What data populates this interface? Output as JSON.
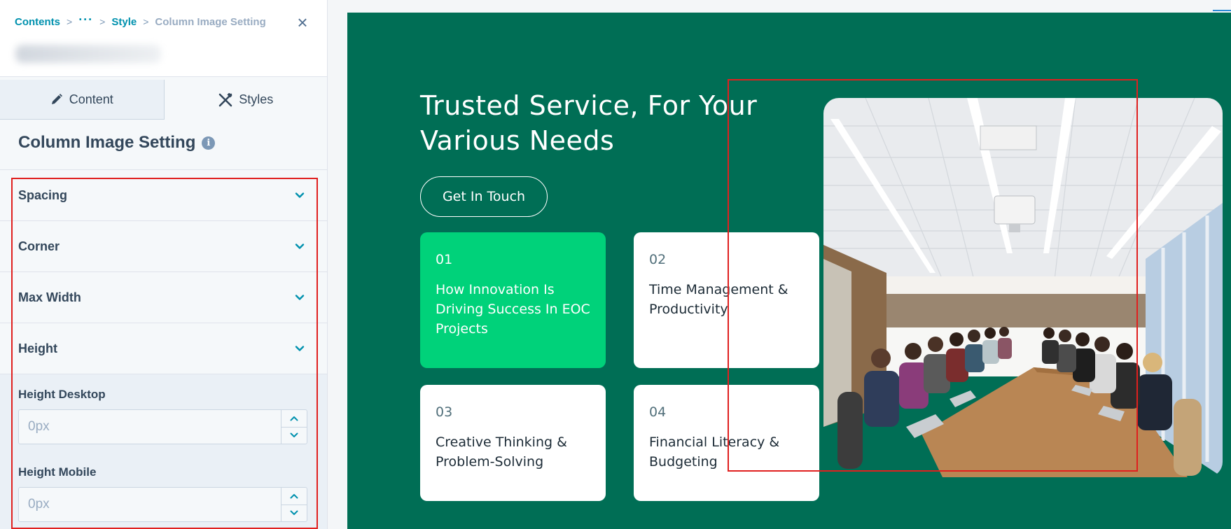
{
  "breadcrumb": {
    "items": [
      "Contents",
      "Style"
    ],
    "current": "Column Image Setting",
    "more": "···",
    "separator": ">"
  },
  "close_icon": "×",
  "tabs": [
    {
      "label": "Content",
      "icon": "pencil-icon"
    },
    {
      "label": "Styles",
      "icon": "brush-tools-icon"
    }
  ],
  "panel": {
    "title": "Column Image Setting",
    "info": "i"
  },
  "accordion": [
    {
      "label": "Spacing"
    },
    {
      "label": "Corner"
    },
    {
      "label": "Max Width"
    },
    {
      "label": "Height"
    }
  ],
  "height_fields": {
    "desktop": {
      "label": "Height Desktop",
      "placeholder": "0px"
    },
    "mobile": {
      "label": "Height Mobile",
      "placeholder": "0px"
    }
  },
  "preview": {
    "headline": "Trusted Service, For Your Various Needs",
    "cta": "Get In Touch",
    "cards": [
      {
        "num": "01",
        "text": "How Innovation Is Driving Success In EOC Projects",
        "active": true
      },
      {
        "num": "02",
        "text": "Time Management & Productivity",
        "active": false
      },
      {
        "num": "03",
        "text": "Creative Thinking & Problem-Solving",
        "active": false
      },
      {
        "num": "04",
        "text": "Financial Literacy & Budgeting",
        "active": false
      }
    ],
    "image_subject": "conference-room-meeting-photo"
  },
  "colors": {
    "accent": "#0091ae",
    "section_bg": "#006e55",
    "card_active": "#00d27a",
    "highlight": "#e0201f"
  }
}
